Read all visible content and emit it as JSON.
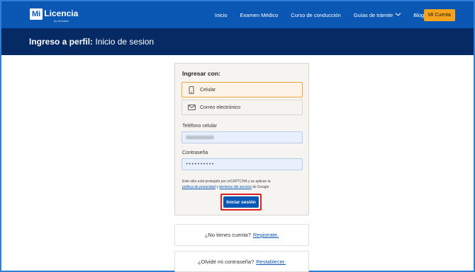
{
  "nav": {
    "logo_box": "Mi",
    "logo_text": "Licencia",
    "logo_sub": "by Humana",
    "links": [
      "Inicio",
      "Examen Médico",
      "Curso de conducción",
      "Guías de trámite",
      "Blog"
    ],
    "cta": "Mi Cuenta"
  },
  "header": {
    "title_bold": "Ingreso a perfil:",
    "title_rest": " Inicio de sesion"
  },
  "login": {
    "title": "Ingresar con:",
    "option_phone": "Celular",
    "option_email": "Correo electrónico",
    "phone_label": "Teléfono celular",
    "phone_value": "",
    "password_label": "Contraseña",
    "password_value": "••••••••••",
    "legal_text_1": "Este sitio está protegido por reCAPTCHA y se aplican la",
    "legal_link_1": "política de privacidad",
    "legal_mid": " y ",
    "legal_link_2": "términos del servicio",
    "legal_end": " de Google.",
    "submit": "Iniciar sesión"
  },
  "register": {
    "text": "¿No tienes cuenta?",
    "link": "Registrate."
  },
  "forgot": {
    "text": "¿Olvidé mi contraseña?",
    "link": "Restablecer."
  },
  "colors": {
    "nav_bg": "#0a58b3",
    "band_bg": "#062a63",
    "cta_bg": "#f7a21b",
    "selected_border": "#f4a53b",
    "highlight_border": "#e02020"
  }
}
